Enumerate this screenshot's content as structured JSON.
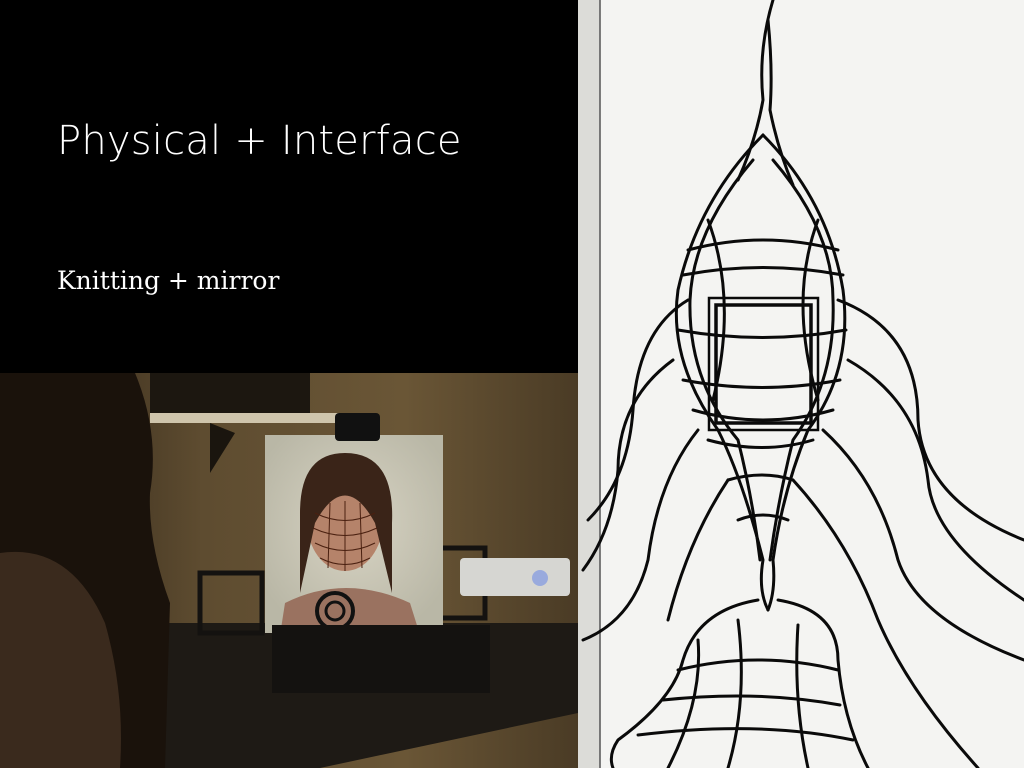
{
  "slide": {
    "title": "Physical + Interface",
    "subtitle": "Knitting + mirror"
  },
  "colors": {
    "background": "#000000",
    "text": "#ffffff",
    "sketch_paper": "#f4f4f2",
    "ink": "#0a0a0a",
    "room_wall": "#5a4a30"
  }
}
